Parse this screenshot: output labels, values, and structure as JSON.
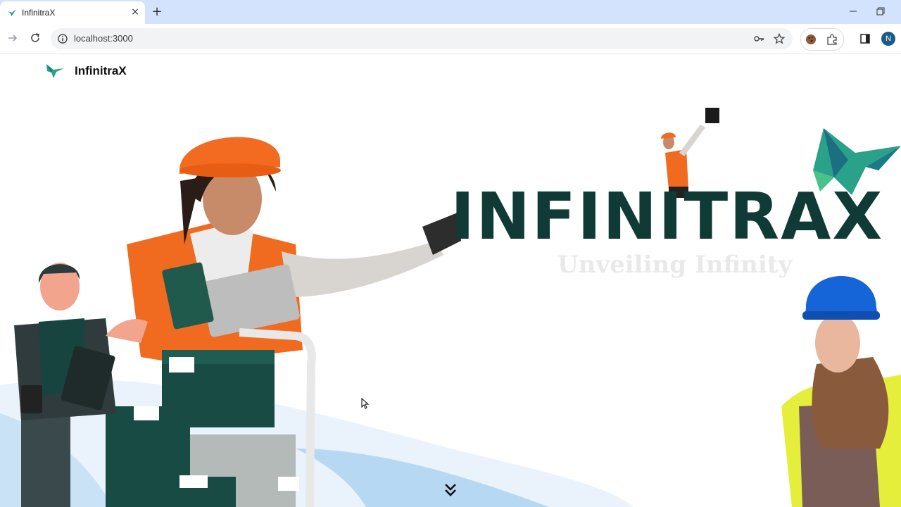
{
  "browser": {
    "tab_title": "InfinitraX",
    "tab_close_glyph": "×",
    "new_tab_glyph": "+",
    "url": "localhost:3000",
    "profile_initial": "N"
  },
  "site": {
    "name": "InfinitraX",
    "logo_icon": "hummingbird-logo-icon"
  },
  "hero": {
    "title": "INFINITRAX",
    "subtitle": "Unveiling Infinity",
    "scroll_icon": "double-chevron-down-icon"
  },
  "colors": {
    "brand_dark": "#0f3a35",
    "safety_orange": "#f06a1f",
    "browser_frame": "#d3e3fd"
  }
}
